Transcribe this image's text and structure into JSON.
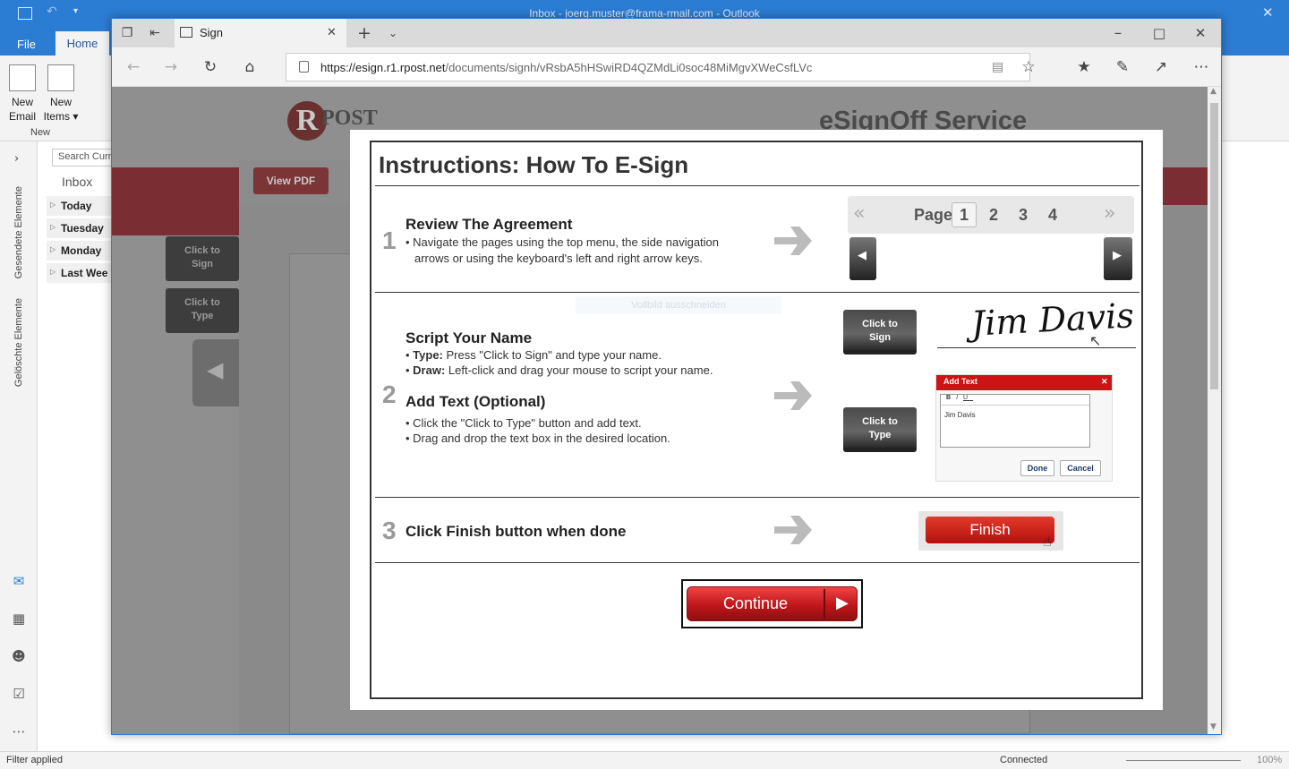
{
  "outlook": {
    "title": "Inbox - joerg.muster@frama-rmail.com  -  Outlook",
    "tabs": {
      "file": "File",
      "home": "Home"
    },
    "ribbon": {
      "new_email": [
        "New",
        "Email"
      ],
      "new_items": [
        "New",
        "Items ▾"
      ],
      "group_label": "New"
    },
    "search_placeholder": "Search Curr",
    "inbox_label": "Inbox",
    "folders": [
      "Today",
      "Tuesday",
      "Monday",
      "Last Wee"
    ],
    "side_labels": {
      "sent": "Gesendete Elemente",
      "deleted": "Gelöschte Elemente"
    },
    "status": {
      "left": "Filter applied",
      "connected": "Connected",
      "zoom": "100%"
    }
  },
  "edge": {
    "tab_title": "Sign",
    "url_domain": "https://esign.r1.rpost.net",
    "url_path": "/documents/signh/vRsbA5hHSwiRD4QZMdLi0soc48MiMgvXWeCsfLVc"
  },
  "page": {
    "logo_text": "POST",
    "logo_letter": "R",
    "header_title": "eSignOff Service",
    "view_pdf": "View PDF",
    "click_to_sign": [
      "Click to",
      "Sign"
    ],
    "click_to_type": [
      "Click to",
      "Type"
    ]
  },
  "modal": {
    "title": "Instructions: How To E-Sign",
    "step1": {
      "num": "1",
      "heading": "Review The Agreement",
      "bullets": [
        "• Navigate the pages using the top menu, the side navigation",
        "arrows or using the keyboard's left and right arrow keys."
      ],
      "page_label": "Page",
      "pages": [
        "1",
        "2",
        "3",
        "4"
      ]
    },
    "step2": {
      "num": "2",
      "ghost_text": "Vollbild ausschneiden",
      "heading_a": "Script Your Name",
      "type_bold": "Type:",
      "type_text": " Press \"Click to Sign\" and type your name.",
      "draw_bold": "Draw:",
      "draw_text": " Left-click and drag your mouse to script your name.",
      "heading_b": "Add Text (Optional)",
      "bullets_b": [
        "• Click the \"Click to Type\" button and add text.",
        "• Drag and drop the text box in the desired location."
      ],
      "signature": "Jim Davis",
      "addtext_title": "Add Text",
      "addtext_value": "Jim Davis",
      "addtext_tools": [
        "B",
        "I",
        "U"
      ],
      "done": "Done",
      "cancel": "Cancel"
    },
    "step3": {
      "num": "3",
      "heading": "Click Finish button when done",
      "finish": "Finish"
    },
    "continue": "Continue"
  }
}
